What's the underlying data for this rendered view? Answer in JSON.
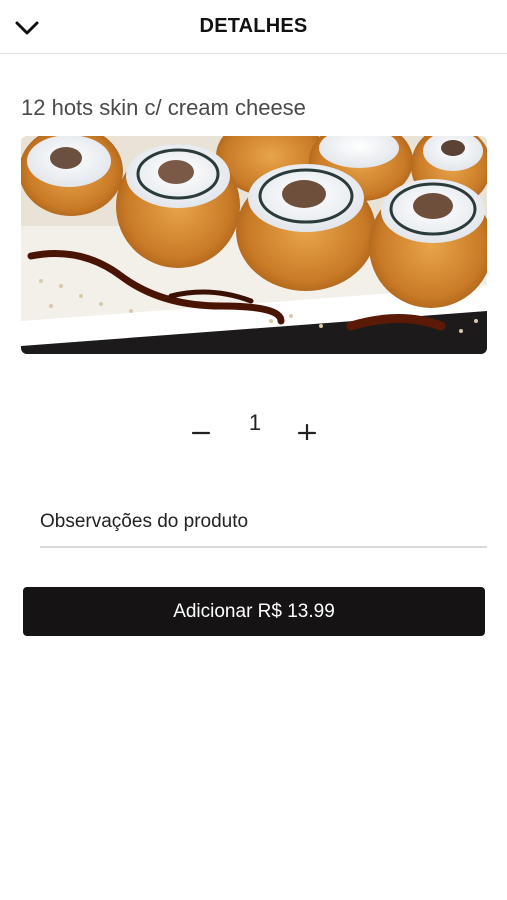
{
  "header": {
    "title": "DETALHES",
    "back_icon": "chevron-down-icon"
  },
  "product": {
    "title": "12 hots skin c/ cream cheese",
    "image_icon": "sushi-photo"
  },
  "quantity": {
    "minus_label": "−",
    "value": "1",
    "plus_label": "+"
  },
  "notes": {
    "placeholder": "Observações do produto",
    "value": ""
  },
  "add_button": {
    "label": "Adicionar R$ 13.99"
  },
  "colors": {
    "button_bg": "#151314",
    "button_text": "#ffffff",
    "title_text": "#4a4a4a"
  }
}
